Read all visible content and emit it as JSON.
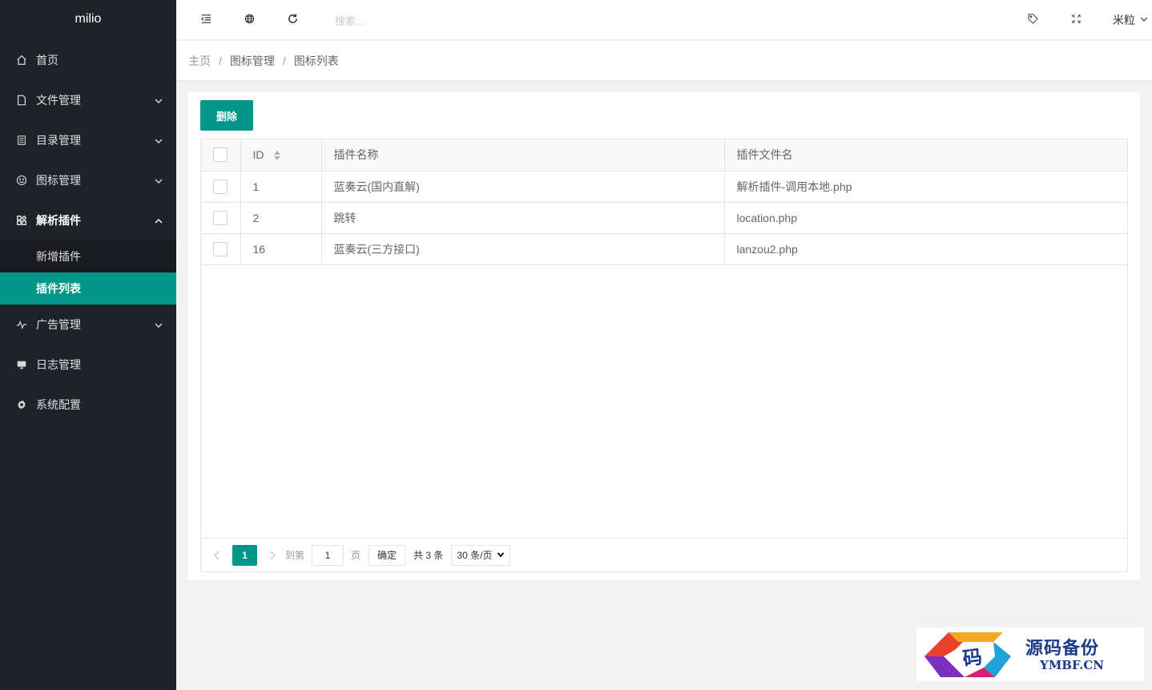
{
  "app": {
    "logo": "milio"
  },
  "sidebar": {
    "items": [
      {
        "label": "首页",
        "icon": "home-icon"
      },
      {
        "label": "文件管理",
        "icon": "file-icon",
        "expandable": true
      },
      {
        "label": "目录管理",
        "icon": "list-icon",
        "expandable": true
      },
      {
        "label": "图标管理",
        "icon": "smile-icon",
        "expandable": true
      },
      {
        "label": "解析插件",
        "icon": "app-icon",
        "expandable": true,
        "expanded": true,
        "children": [
          {
            "label": "新增插件"
          },
          {
            "label": "插件列表",
            "active": true
          }
        ]
      },
      {
        "label": "广告管理",
        "icon": "chart-icon",
        "expandable": true
      },
      {
        "label": "日志管理",
        "icon": "log-icon"
      },
      {
        "label": "系统配置",
        "icon": "settings-icon"
      }
    ]
  },
  "header": {
    "search_placeholder": "搜索...",
    "user": "米粒"
  },
  "breadcrumb": [
    "主页",
    "图标管理",
    "图标列表"
  ],
  "toolbar": {
    "delete_label": "删除"
  },
  "table": {
    "columns": [
      "ID",
      "插件名称",
      "插件文件名"
    ],
    "rows": [
      {
        "id": "1",
        "name": "蓝奏云(国内直解)",
        "file": "解析插件-调用本地.php"
      },
      {
        "id": "2",
        "name": "跳转",
        "file": "location.php"
      },
      {
        "id": "16",
        "name": "蓝奏云(三方接口)",
        "file": "lanzou2.php"
      }
    ]
  },
  "pager": {
    "current": "1",
    "goto_label": "到第",
    "goto_value": "1",
    "page_label": "页",
    "confirm_label": "确定",
    "total": "共 3 条",
    "per_page": "30 条/页"
  },
  "watermark": {
    "title": "源码备份",
    "domain": "YMBF.CN"
  },
  "colors": {
    "sidebar_bg": "#20222a",
    "accent": "#009688"
  }
}
